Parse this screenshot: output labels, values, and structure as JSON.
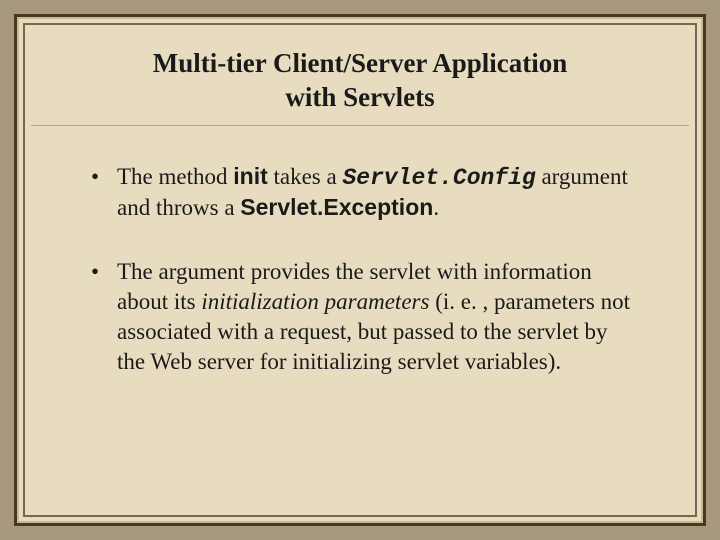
{
  "title": {
    "line1": "Multi-tier Client/Server Application",
    "line2": "with Servlets"
  },
  "bullets": {
    "b1": {
      "p1": "The method ",
      "init": "init",
      "p2": " takes a ",
      "servletConfig": "Servlet.Config",
      "p3": " argument and throws a ",
      "servletException": "Servlet.Exception",
      "p4": "."
    },
    "b2": {
      "p1": "The argument provides the servlet with information about its ",
      "em": "initialization parameters",
      "p2": " (i. e. , parameters not associated with a request, but passed to the servlet by the Web server for initializing servlet variables)."
    }
  }
}
